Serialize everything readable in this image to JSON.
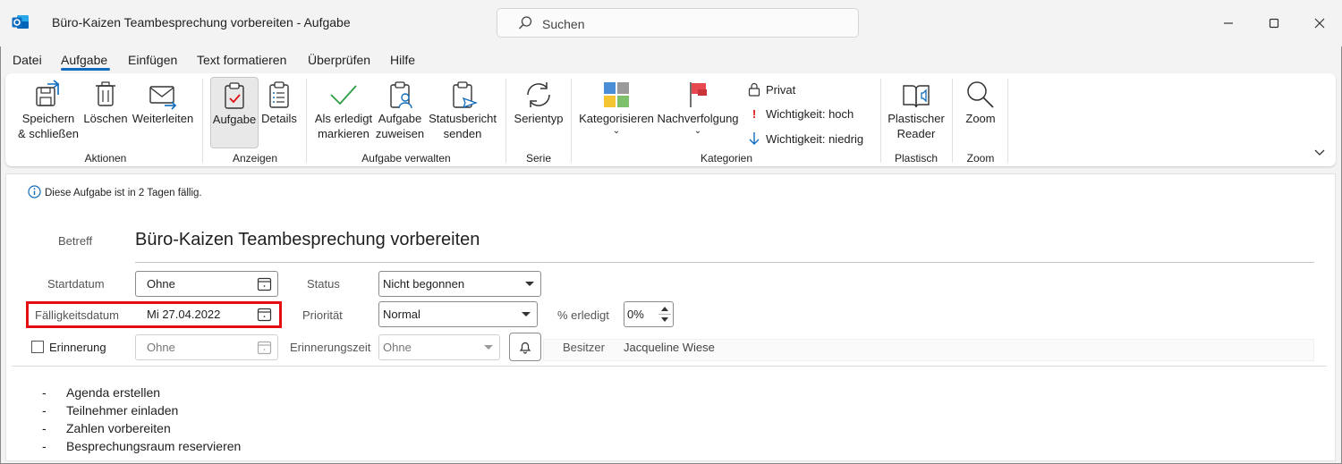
{
  "window": {
    "title": "Büro-Kaizen Teambesprechung vorbereiten  -  Aufgabe",
    "search_placeholder": "Suchen"
  },
  "menu": {
    "tabs": [
      "Datei",
      "Aufgabe",
      "Einfügen",
      "Text formatieren",
      "Überprüfen",
      "Hilfe"
    ],
    "active": "Aufgabe"
  },
  "ribbon": {
    "groups": {
      "aktionen": "Aktionen",
      "anzeigen": "Anzeigen",
      "aufgabe_verwalten": "Aufgabe verwalten",
      "serie": "Serie",
      "kategorien": "Kategorien",
      "plastisch": "Plastisch",
      "zoom": "Zoom"
    },
    "buttons": {
      "save_close": [
        "Speichern",
        "& schließen"
      ],
      "delete": "Löschen",
      "forward": "Weiterleiten",
      "task": "Aufgabe",
      "details": "Details",
      "mark_complete": [
        "Als erledigt",
        "markieren"
      ],
      "assign": [
        "Aufgabe",
        "zuweisen"
      ],
      "status_report": [
        "Statusbericht",
        "senden"
      ],
      "recurrence": "Serientyp",
      "categorize": "Kategorisieren",
      "follow_up": "Nachverfolgung",
      "private": "Privat",
      "importance_high": "Wichtigkeit: hoch",
      "importance_low": "Wichtigkeit: niedrig",
      "immersive_reader": [
        "Plastischer",
        "Reader"
      ],
      "zoom": "Zoom"
    }
  },
  "form": {
    "info": "Diese Aufgabe ist in 2 Tagen fällig.",
    "subject_label": "Betreff",
    "subject": "Büro-Kaizen Teambesprechung vorbereiten",
    "start_label": "Startdatum",
    "start_value": "Ohne",
    "due_label": "Fälligkeitsdatum",
    "due_value": "Mi 27.04.2022",
    "reminder_label": "Erinnerung",
    "reminder_date": "Ohne",
    "status_label": "Status",
    "status_value": "Nicht begonnen",
    "priority_label": "Priorität",
    "priority_value": "Normal",
    "reminder_time_label": "Erinnerungszeit",
    "reminder_time_value": "Ohne",
    "percent_label": "% erledigt",
    "percent_value": "0%",
    "owner_label": "Besitzer",
    "owner_value": "Jacqueline Wiese"
  },
  "body": {
    "items": [
      "Agenda erstellen",
      "Teilnehmer einladen",
      "Zahlen vorbereiten",
      "Besprechungsraum reservieren"
    ]
  },
  "colors": {
    "accent": "#0f6cbd",
    "highlight": "#e10f14"
  }
}
